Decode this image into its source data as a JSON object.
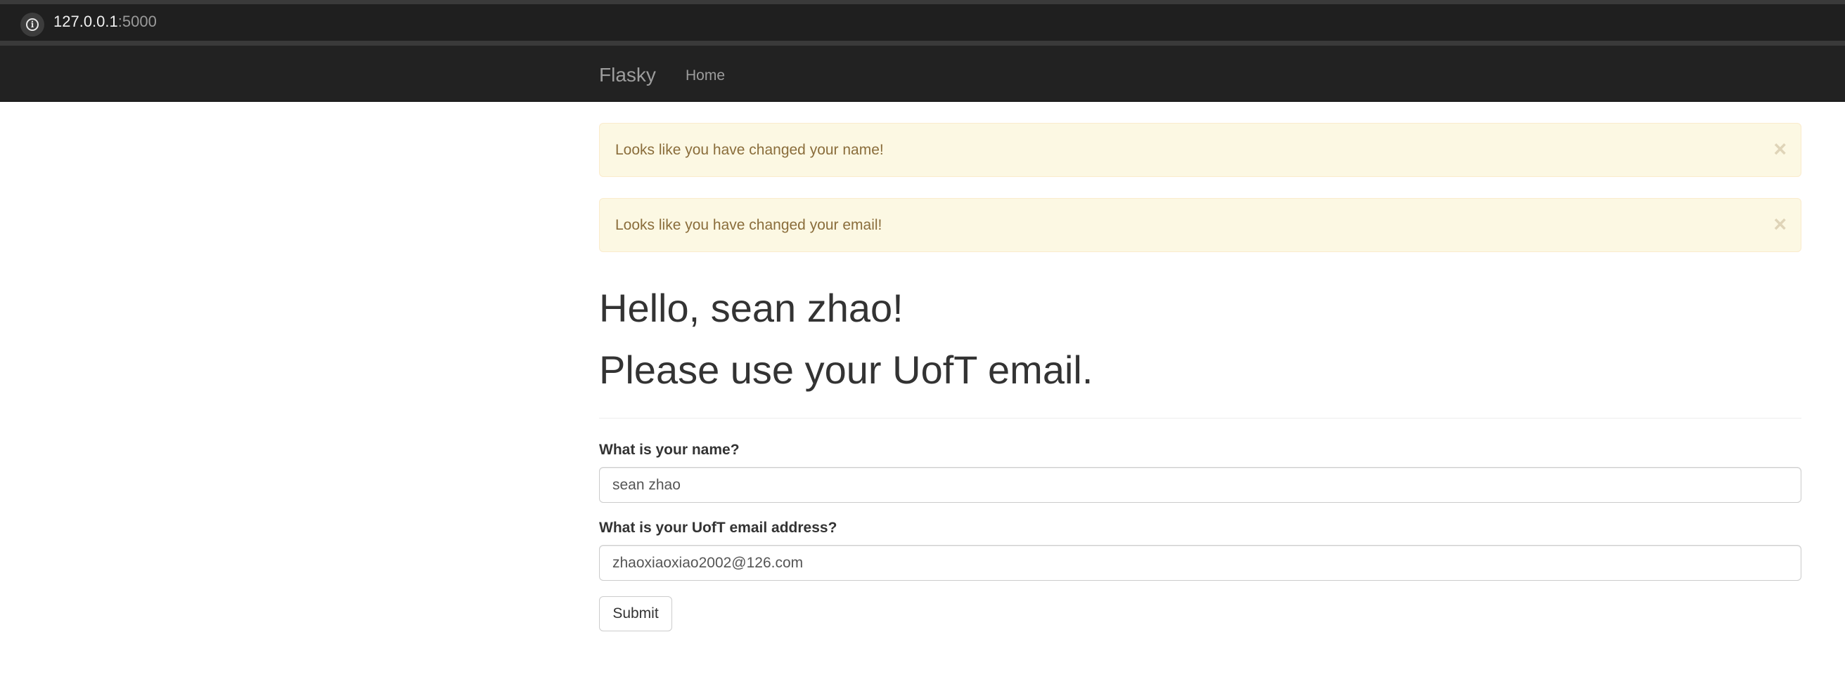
{
  "browser": {
    "url_host": "127.0.0.1",
    "url_port": ":5000",
    "info_icon": "info-icon"
  },
  "navbar": {
    "brand": "Flasky",
    "home": "Home"
  },
  "alerts": [
    {
      "message": "Looks like you have changed your name!",
      "close": "×"
    },
    {
      "message": "Looks like you have changed your email!",
      "close": "×"
    }
  ],
  "header": {
    "greeting": "Hello, sean zhao!",
    "instruction": "Please use your UofT email."
  },
  "form": {
    "name_label": "What is your name?",
    "name_value": "sean zhao",
    "email_label": "What is your UofT email address?",
    "email_value": "zhaoxiaoxiao2002@126.com",
    "submit_label": "Submit"
  },
  "colors": {
    "navbar_bg": "#222222",
    "alert_bg": "#fcf8e3",
    "alert_text": "#8a6d3b"
  }
}
